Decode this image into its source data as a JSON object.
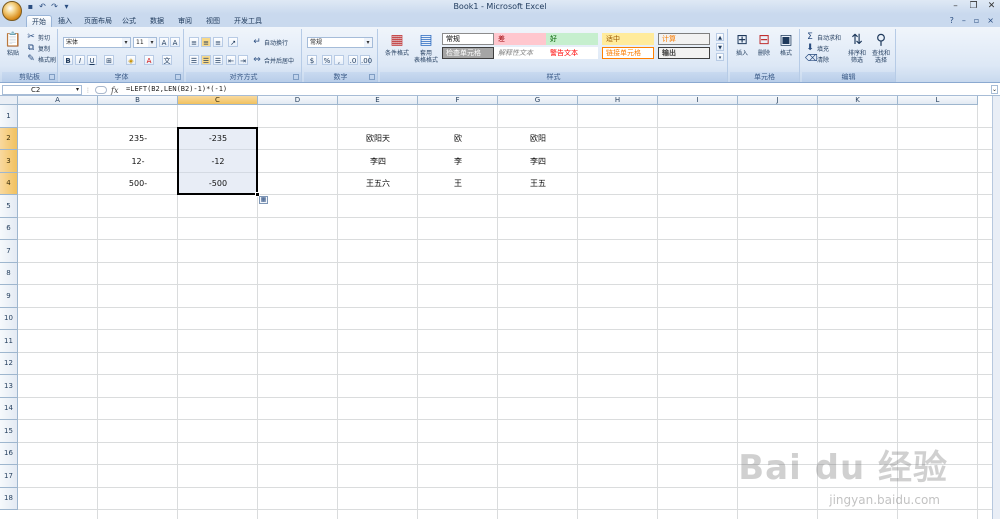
{
  "app": {
    "title": "Book1 - Microsoft Excel"
  },
  "quick_access": {
    "icons": [
      "save-icon",
      "undo-icon",
      "redo-icon",
      "customize-icon"
    ]
  },
  "tabs": [
    "开始",
    "插入",
    "页面布局",
    "公式",
    "数据",
    "审阅",
    "视图",
    "开发工具"
  ],
  "active_tab": "开始",
  "ribbon": {
    "clipboard": {
      "label": "剪贴板",
      "paste": "粘贴",
      "cut": "剪切",
      "copy": "复制",
      "format_painter": "格式刷"
    },
    "font": {
      "label": "字体",
      "name": "宋体",
      "size": "11",
      "bold": "B",
      "italic": "I",
      "underline": "U"
    },
    "alignment": {
      "label": "对齐方式",
      "wrap": "自动换行",
      "merge": "合并后居中"
    },
    "number": {
      "label": "数字",
      "format": "常规",
      "percent": "%"
    },
    "styles": {
      "label": "样式",
      "conditional": "条件格式",
      "table_format": "套用\n表格格式",
      "cells": [
        {
          "text": "常规",
          "bg": "#ffffff",
          "fg": "#000000",
          "border": "#8c8c8c"
        },
        {
          "text": "差",
          "bg": "#ffc7ce",
          "fg": "#9c0006",
          "border": "#ffc7ce"
        },
        {
          "text": "好",
          "bg": "#c6efce",
          "fg": "#006100",
          "border": "#c6efce"
        },
        {
          "text": "适中",
          "bg": "#ffeb9c",
          "fg": "#9c5700",
          "border": "#ffeb9c"
        },
        {
          "text": "计算",
          "bg": "#f2f2f2",
          "fg": "#fa7d00",
          "border": "#7f7f7f"
        },
        {
          "text": "检查单元格",
          "bg": "#a5a5a5",
          "fg": "#ffffff",
          "border": "#3f3f3f"
        },
        {
          "text": "解释性文本",
          "bg": "#ffffff",
          "fg": "#7f7f7f",
          "border": "#ffffff"
        },
        {
          "text": "警告文本",
          "bg": "#ffffff",
          "fg": "#ff0000",
          "border": "#ffffff"
        },
        {
          "text": "链接单元格",
          "bg": "#ffffff",
          "fg": "#fa7d00",
          "border": "#ff8001"
        },
        {
          "text": "输出",
          "bg": "#f2f2f2",
          "fg": "#3f3f3f",
          "border": "#3f3f3f"
        }
      ]
    },
    "cells_group": {
      "label": "单元格",
      "insert": "插入",
      "delete": "删除",
      "format": "格式"
    },
    "editing": {
      "label": "编辑",
      "autosum": "自动求和",
      "fill": "填充",
      "clear": "清除",
      "sort": "排序和\n筛选",
      "find": "查找和\n选择"
    }
  },
  "formula_bar": {
    "name_box": "C2",
    "fx": "fx",
    "formula": "=LEFT(B2,LEN(B2)-1)*(-1)"
  },
  "columns": [
    "A",
    "B",
    "C",
    "D",
    "E",
    "F",
    "G",
    "H",
    "I",
    "J",
    "K",
    "L"
  ],
  "rows": [
    "1",
    "2",
    "3",
    "4",
    "5",
    "6",
    "7",
    "8",
    "9",
    "10",
    "11",
    "12",
    "13",
    "14",
    "15",
    "16",
    "17",
    "18"
  ],
  "selected": {
    "column": "C",
    "rows": [
      "2",
      "3",
      "4"
    ]
  },
  "cells": {
    "B2": "235-",
    "C2": "-235",
    "E2": "欧阳天",
    "F2": "欧",
    "G2": "欧阳",
    "B3": "12-",
    "C3": "-12",
    "E3": "李四",
    "F3": "李",
    "G3": "李四",
    "B4": "500-",
    "C4": "-500",
    "E4": "王五六",
    "F4": "王",
    "G4": "王五"
  },
  "watermark": {
    "brand": "Bai du 经验",
    "url": "jingyan.baidu.com"
  }
}
